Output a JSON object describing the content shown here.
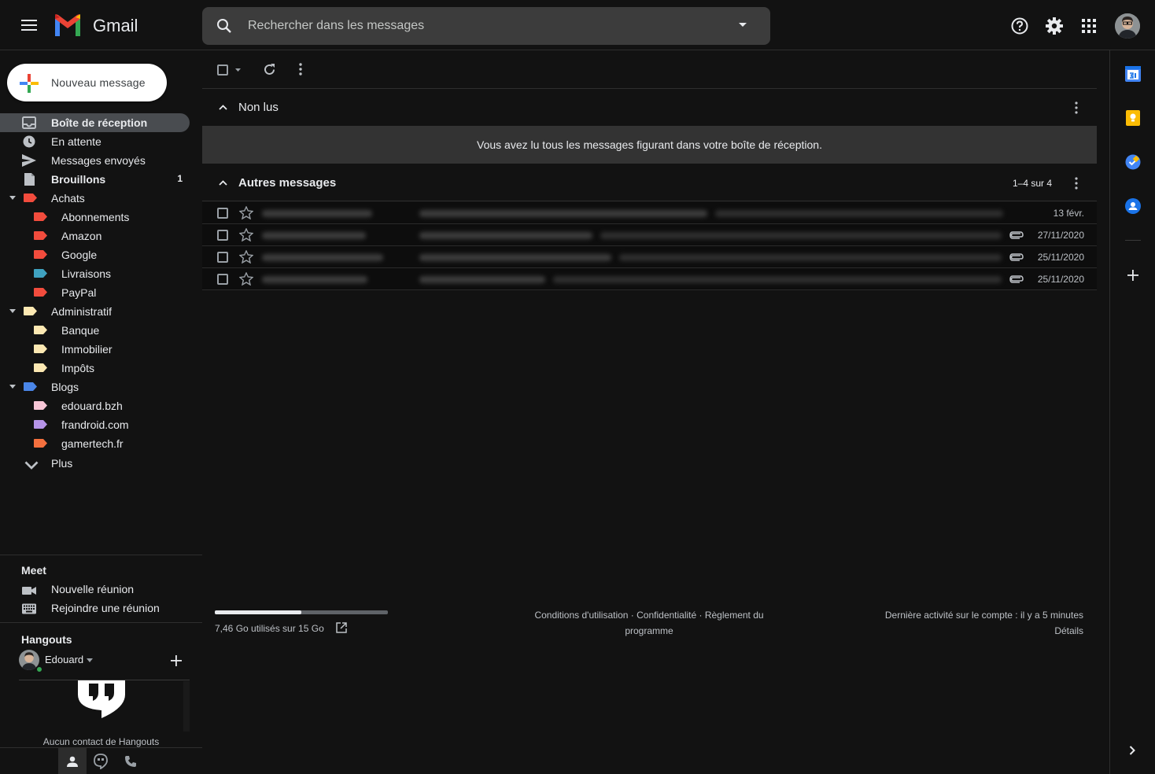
{
  "app": {
    "name": "Gmail"
  },
  "search": {
    "placeholder": "Rechercher dans les messages"
  },
  "compose": {
    "label": "Nouveau message"
  },
  "nav": [
    {
      "label": "Boîte de réception",
      "icon": "inbox-icon",
      "active": true,
      "bold": true
    },
    {
      "label": "En attente",
      "icon": "clock-icon"
    },
    {
      "label": "Messages envoyés",
      "icon": "send-icon"
    },
    {
      "label": "Brouillons",
      "icon": "draft-icon",
      "bold": true,
      "count": "1"
    }
  ],
  "labels": [
    {
      "label": "Achats",
      "color": "#f24c3d",
      "level": 0,
      "expanded": true
    },
    {
      "label": "Abonnements",
      "color": "#f24c3d",
      "level": 1
    },
    {
      "label": "Amazon",
      "color": "#f24c3d",
      "level": 1
    },
    {
      "label": "Google",
      "color": "#f24c3d",
      "level": 1
    },
    {
      "label": "Livraisons",
      "color": "#3fa2c0",
      "level": 1
    },
    {
      "label": "PayPal",
      "color": "#f24c3d",
      "level": 1
    },
    {
      "label": "Administratif",
      "color": "#fce8b2",
      "level": 0,
      "expanded": true
    },
    {
      "label": "Banque",
      "color": "#fce8b2",
      "level": 1
    },
    {
      "label": "Immobilier",
      "color": "#fce8b2",
      "level": 1
    },
    {
      "label": "Impôts",
      "color": "#fce8b2",
      "level": 1
    },
    {
      "label": "Blogs",
      "color": "#4a86e8",
      "level": 0,
      "expanded": true
    },
    {
      "label": "edouard.bzh",
      "color": "#f7c6d6",
      "level": 1
    },
    {
      "label": "frandroid.com",
      "color": "#b694e8",
      "level": 1
    },
    {
      "label": "gamertech.fr",
      "color": "#f4703e",
      "level": 1
    }
  ],
  "more": {
    "label": "Plus"
  },
  "meet": {
    "title": "Meet",
    "items": [
      {
        "label": "Nouvelle réunion",
        "icon": "videocam-icon"
      },
      {
        "label": "Rejoindre une réunion",
        "icon": "keyboard-icon"
      }
    ]
  },
  "hangouts": {
    "title": "Hangouts",
    "user": "Edouard",
    "empty_text": "Aucun contact de Hangouts"
  },
  "sections": {
    "unread": {
      "title": "Non lus",
      "empty_message": "Vous avez lu tous les messages figurant dans votre boîte de réception."
    },
    "others": {
      "title": "Autres messages",
      "count": "1–4 sur 4"
    }
  },
  "messages": [
    {
      "sender": "",
      "subject": "",
      "snippet": "",
      "date": "13 févr.",
      "attachment": false
    },
    {
      "sender": "",
      "subject": "",
      "snippet": "",
      "date": "27/11/2020",
      "attachment": true
    },
    {
      "sender": "",
      "subject": "",
      "snippet": "",
      "date": "25/11/2020",
      "attachment": true
    },
    {
      "sender": "",
      "subject": "",
      "snippet": "",
      "date": "25/11/2020",
      "attachment": true
    }
  ],
  "footer": {
    "storage": "7,46 Go utilisés sur 15 Go",
    "storage_used_fraction": 0.5,
    "links_line1": "Conditions d'utilisation · Confidentialité · Règlement du",
    "links_line2": "programme",
    "activity": "Dernière activité sur le compte : il y a 5 minutes",
    "details": "Détails"
  },
  "colors": {
    "background": "#121212",
    "accent_active": "#494c50"
  }
}
